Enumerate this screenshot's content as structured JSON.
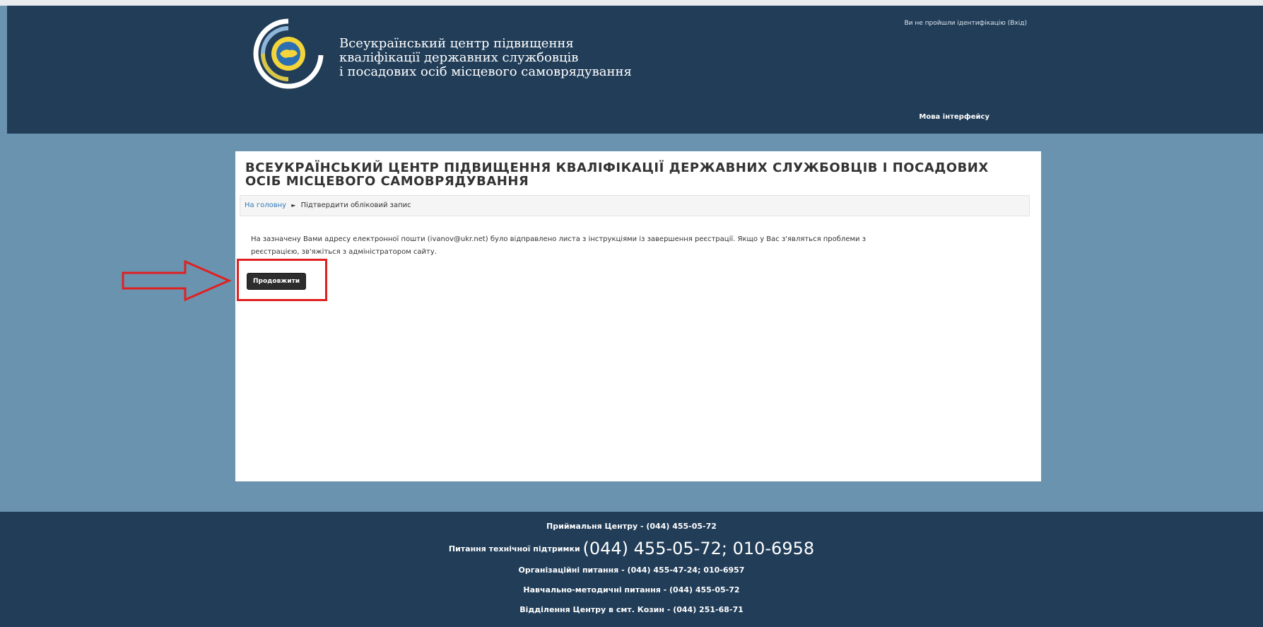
{
  "header": {
    "org_name_line1": "Всеукраїнський центр підвищення",
    "org_name_line2": "кваліфікації державних службовців",
    "org_name_line3": "і посадових осіб місцевого самоврядування",
    "login_info": "Ви не пройшли ідентифікацію (Вхід)",
    "language_menu": "Мова інтерфейсу",
    "logo_icon": "org-emblem"
  },
  "main": {
    "title": "ВСЕУКРАЇНСЬКИЙ ЦЕНТР ПІДВИЩЕННЯ КВАЛІФІКАЦІЇ ДЕРЖАВНИХ СЛУЖБОВЦІВ І ПОСАДОВИХ ОСІБ МІСЦЕВОГО САМОВРЯДУВАННЯ",
    "breadcrumb": {
      "home": "На головну",
      "separator": "►",
      "current": "Підтвердити обліковий запис"
    },
    "message_line1": "На зазначену Вами адресу електронної пошти (ivanov@ukr.net) було відправлено листа з інструкціями із завершення реєстрації. Якщо у Вас з'являться проблеми з",
    "message_line2": "реєстрацією, зв'яжіться з адміністратором сайту.",
    "continue_button": "Продовжити"
  },
  "annotation": {
    "highlight_color": "#e02020",
    "arrow_icon": "right-arrow-outline"
  },
  "footer": {
    "reception": "Приймальня Центру - (044) 455-05-72",
    "support_label": "Питання технічної підтримки",
    "support_phones": "(044) 455-05-72; 010-6958",
    "organizational": "Організаційні питання - (044) 455-47-24; 010-6957",
    "educational": "Навчально-методичні питання - (044) 455-05-72",
    "branch": "Відділення Центру в смт. Козин - (044) 251-68-71"
  },
  "colors": {
    "header_bg": "#213d58",
    "page_bg": "#6a93b0",
    "button_bg": "#2d2d2d",
    "link": "#2f7ab8"
  }
}
